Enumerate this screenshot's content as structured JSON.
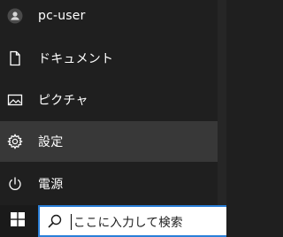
{
  "start_menu": {
    "items": [
      {
        "label": "pc-user",
        "icon": "user-avatar-icon"
      },
      {
        "label": "ドキュメント",
        "icon": "document-icon"
      },
      {
        "label": "ピクチャ",
        "icon": "pictures-icon"
      },
      {
        "label": "設定",
        "icon": "gear-icon",
        "highlighted": true
      },
      {
        "label": "電源",
        "icon": "power-icon"
      }
    ]
  },
  "taskbar": {
    "start_icon": "windows-logo-icon",
    "search": {
      "icon": "search-icon",
      "placeholder": "ここに入力して検索"
    }
  },
  "colors": {
    "menu_background": "#1f1f1f",
    "hover_background": "#383838",
    "taskbar_background": "#1a1a1a",
    "search_border": "#2a7fd8",
    "text": "#ffffff"
  }
}
